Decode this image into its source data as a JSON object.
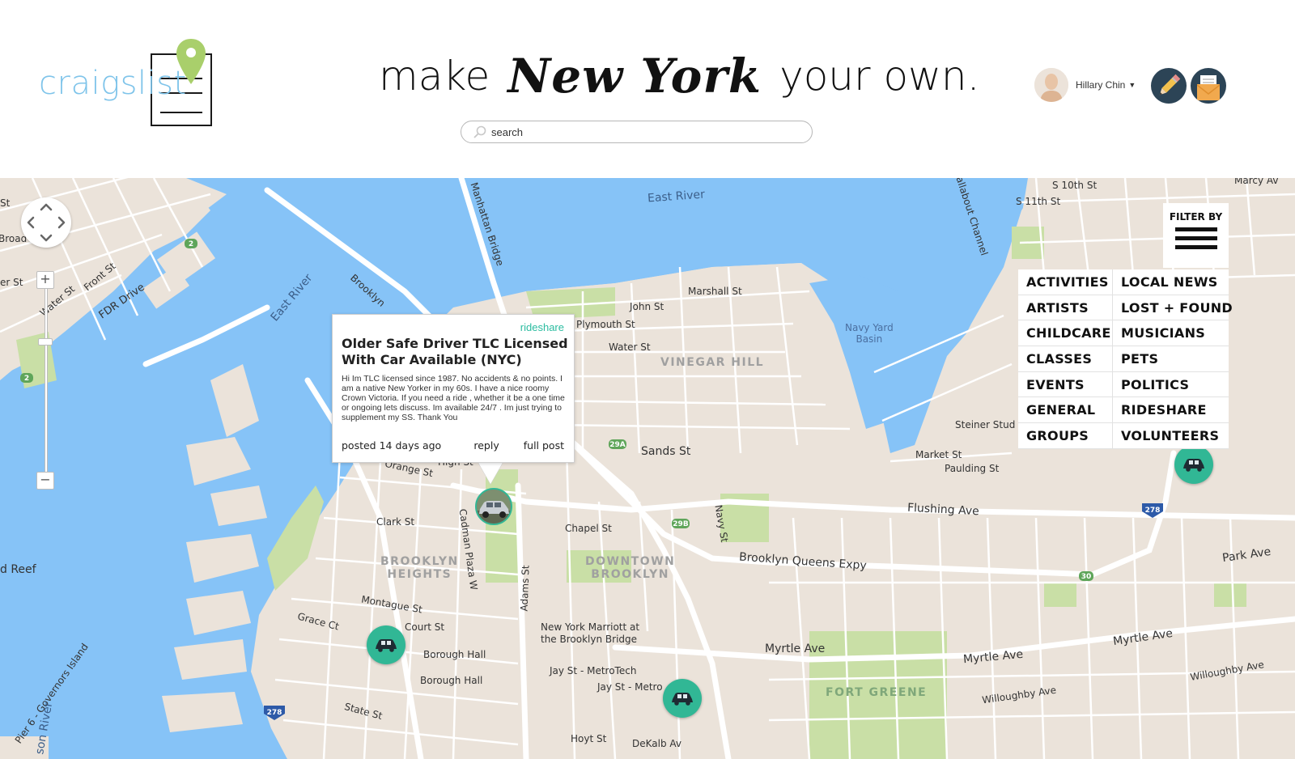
{
  "header": {
    "logo_text": "craigslist",
    "tagline_pre": "make",
    "tagline_city": "New York",
    "tagline_post": "your own.",
    "search_placeholder": "search",
    "user_name": "Hillary Chin"
  },
  "icons": {
    "search": "search-icon",
    "post": "pencil-icon",
    "messages": "envelope-icon",
    "pin": "location-pin-icon",
    "car": "car-icon"
  },
  "colors": {
    "brand": "#7fc4ea",
    "accent": "#31b795",
    "category": "#2bbca0",
    "water": "#86c3f7",
    "land": "#ebe3da",
    "park": "#c9dfa6"
  },
  "map": {
    "labels": {
      "east_river_top": "East River",
      "east_river_left": "East River",
      "manhattan_bridge": "Manhattan Bridge",
      "brooklyn": "Brooklyn",
      "navy_yard_basin": "Navy Yard\nBasin",
      "vinegar_hill": "VINEGAR HILL",
      "brooklyn_heights": "BROOKLYN\nHEIGHTS",
      "downtown_brooklyn": "DOWNTOWN\nBROOKLYN",
      "fort_greene": "FORT GREENE",
      "sands_st": "Sands St",
      "flushing_ave": "Flushing Ave",
      "bqe": "Brooklyn Queens Expy",
      "myrtle_ave_1": "Myrtle Ave",
      "myrtle_ave_2": "Myrtle Ave",
      "myrtle_ave_3": "Myrtle Ave",
      "park_ave": "Park Ave",
      "clark_st": "Clark St",
      "court_st": "Court St",
      "borough_hall_1": "Borough Hall",
      "borough_hall_2": "Borough Hall",
      "jay_st_metrotech": "Jay St - MetroTech",
      "jay_st_metro": "Jay St - Metro",
      "dekalb_av": "DeKalb Av",
      "hoyt_st": "Hoyt St",
      "marriott": "New York Marriott at\nthe Brooklyn Bridge",
      "steiner": "Steiner Stud",
      "fdr_drive": "FDR Drive",
      "water_st": "Water St",
      "front_st": "Front St",
      "marshall_st": "Marshall St",
      "john_st": "John St",
      "plymouth_st": "Plymouth St",
      "water_st_2": "Water St",
      "market_st": "Market St",
      "paulding_st": "Paulding St",
      "chapel_st": "Chapel St",
      "montague_st": "Montague St",
      "grace_ct": "Grace Ct",
      "state_st": "State St",
      "red_reef": "d Reef",
      "governors": "Pier 6 - Governors Island",
      "hudson": "son River",
      "marcy": "Marcy Av",
      "s10th": "S 10th St",
      "s11th": "S 11th St",
      "wallabout": "allabout Channel",
      "willoughby": "Willoughby Ave",
      "willoughby_2": "Willoughby Ave",
      "cadman": "Cadman Plaza W",
      "adams": "Adams St",
      "navy_st": "Navy St",
      "high_st": "High St",
      "orange_st": "Orange St",
      "broad": "Broad",
      "st": "St",
      "er_st": "er St"
    },
    "popup": {
      "category": "rideshare",
      "title": "Older Safe Driver TLC Licensed With Car Available (NYC)",
      "body": "Hi Im TLC licensed since 1987. No accidents & no points. I am a native New Yorker in my 60s. I have a nice roomy Crown Victoria. If you need a ride , whether it be a one time or ongoing lets discuss. Im available 24/7 . Im just trying to supplement my SS. Thank You",
      "posted": "posted 14 days ago",
      "reply": "reply",
      "full_post": "full post"
    },
    "zoom_in": "+",
    "zoom_out": "−"
  },
  "filter": {
    "label": "FILTER BY",
    "left": [
      "ACTIVITIES",
      "ARTISTS",
      "CHILDCARE",
      "CLASSES",
      "EVENTS",
      "GENERAL",
      "GROUPS"
    ],
    "right": [
      "LOCAL NEWS",
      "LOST + FOUND",
      "MUSICIANS",
      "PETS",
      "POLITICS",
      "RIDESHARE",
      "VOLUNTEERS"
    ]
  }
}
